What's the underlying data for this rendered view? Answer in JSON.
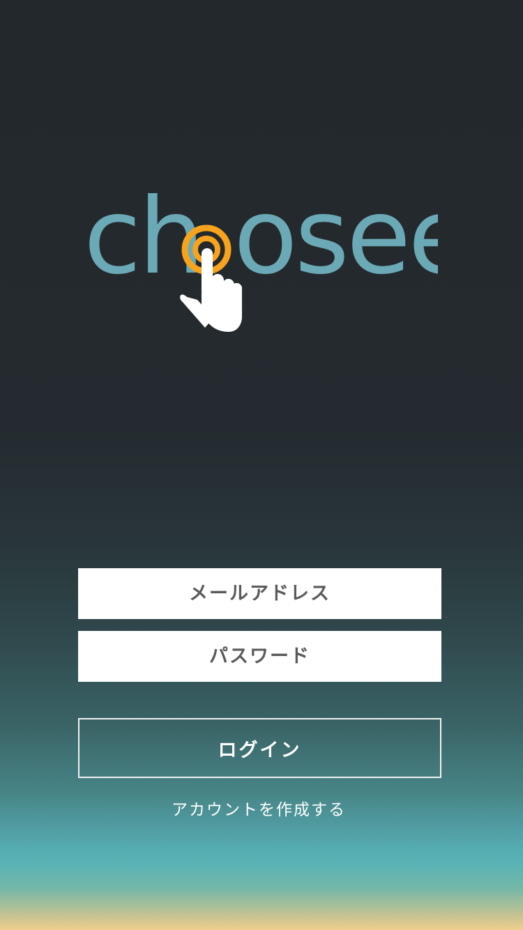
{
  "logo": {
    "text_left": "ch",
    "text_right": "osee",
    "icon": "tap-hand-icon",
    "text_color": "#6aa9b5",
    "ring_color": "#f7a31e",
    "hand_color": "#ffffff"
  },
  "form": {
    "email_placeholder": "メールアドレス",
    "password_placeholder": "パスワード",
    "login_label": "ログイン",
    "create_account_label": "アカウントを作成する"
  }
}
